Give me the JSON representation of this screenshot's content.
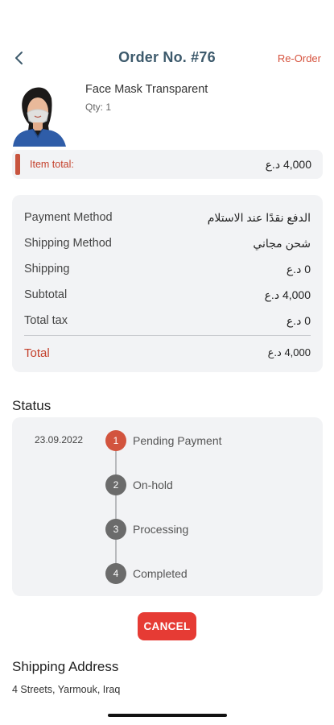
{
  "header": {
    "title": "Order No. #76",
    "reorder_label": "Re-Order"
  },
  "product": {
    "name": "Face Mask Transparent",
    "qty": "Qty: 1"
  },
  "item_total": {
    "label": "Item total:",
    "value": "4,000 د.ع"
  },
  "summary": {
    "rows": [
      {
        "key": "Payment Method",
        "value": "الدفع نقدًا عند الاستلام"
      },
      {
        "key": "Shipping Method",
        "value": "شحن مجاني"
      },
      {
        "key": "Shipping",
        "value": "0 د.ع"
      },
      {
        "key": "Subtotal",
        "value": "4,000 د.ع"
      },
      {
        "key": "Total tax",
        "value": "0 د.ع"
      }
    ],
    "total": {
      "key": "Total",
      "value": "4,000 د.ع"
    }
  },
  "status": {
    "title": "Status",
    "steps": [
      {
        "number": "1",
        "name": "Pending Payment",
        "date": "23.09.2022",
        "active": true
      },
      {
        "number": "2",
        "name": "On-hold",
        "date": "",
        "active": false
      },
      {
        "number": "3",
        "name": "Processing",
        "date": "",
        "active": false
      },
      {
        "number": "4",
        "name": "Completed",
        "date": "",
        "active": false
      }
    ]
  },
  "actions": {
    "cancel_label": "CANCEL"
  },
  "shipping": {
    "title": "Shipping Address",
    "address": "4 Streets, Yarmouk, Iraq"
  },
  "colors": {
    "accent": "#d2543e",
    "title": "#3d5a6c",
    "cancel": "#e63b34",
    "card": "#f2f3f5"
  }
}
